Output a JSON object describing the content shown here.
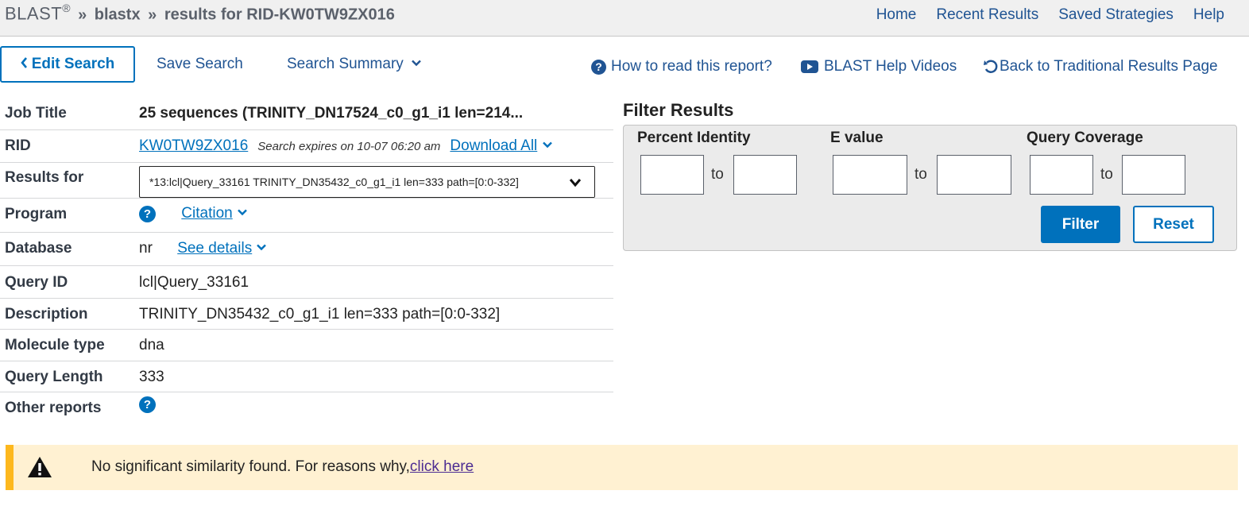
{
  "header": {
    "brand": "BLAST",
    "reg": "®",
    "sep": "»",
    "program": "blastx",
    "results_for": "results for RID-KW0TW9ZX016",
    "nav": [
      "Home",
      "Recent Results",
      "Saved Strategies",
      "Help"
    ]
  },
  "toolbar": {
    "edit_search": "Edit Search",
    "save_search": "Save Search",
    "search_summary": "Search Summary",
    "how_to_read": "How to read this report?",
    "help_videos": "BLAST Help Videos",
    "back_link": "Back to Traditional Results Page"
  },
  "info": {
    "job_title_label": "Job Title",
    "job_title": "25 sequences (TRINITY_DN17524_c0_g1_i1 len=214...",
    "rid_label": "RID",
    "rid": "KW0TW9ZX016",
    "expires": "Search expires on 10-07 06:20 am",
    "download_all": "Download All",
    "results_for_label": "Results for",
    "results_for_value": "*13:lcl|Query_33161 TRINITY_DN35432_c0_g1_i1 len=333 path=[0:0-332]",
    "program_label": "Program",
    "citation": "Citation",
    "database_label": "Database",
    "database": "nr",
    "see_details": "See details",
    "query_id_label": "Query ID",
    "query_id": "lcl|Query_33161",
    "description_label": "Description",
    "description": "TRINITY_DN35432_c0_g1_i1 len=333 path=[0:0-332]",
    "molecule_type_label": "Molecule type",
    "molecule_type": "dna",
    "query_length_label": "Query Length",
    "query_length": "333",
    "other_reports_label": "Other reports"
  },
  "filter": {
    "title": "Filter Results",
    "percent_identity": "Percent Identity",
    "e_value": "E value",
    "query_coverage": "Query Coverage",
    "to": "to",
    "filter_btn": "Filter",
    "reset_btn": "Reset"
  },
  "alert": {
    "message": "No significant similarity found. For reasons why,",
    "link": "click here"
  },
  "icons": {
    "question": "?",
    "warning": "warning-icon",
    "youtube": "youtube-icon",
    "undo": "undo-icon",
    "chevron_left": "‹",
    "chevron_down": "⌄"
  },
  "colors": {
    "link": "#0071bc",
    "nav": "#205493",
    "alert_bg": "#fff1d2",
    "alert_bar": "#fdb81e"
  }
}
